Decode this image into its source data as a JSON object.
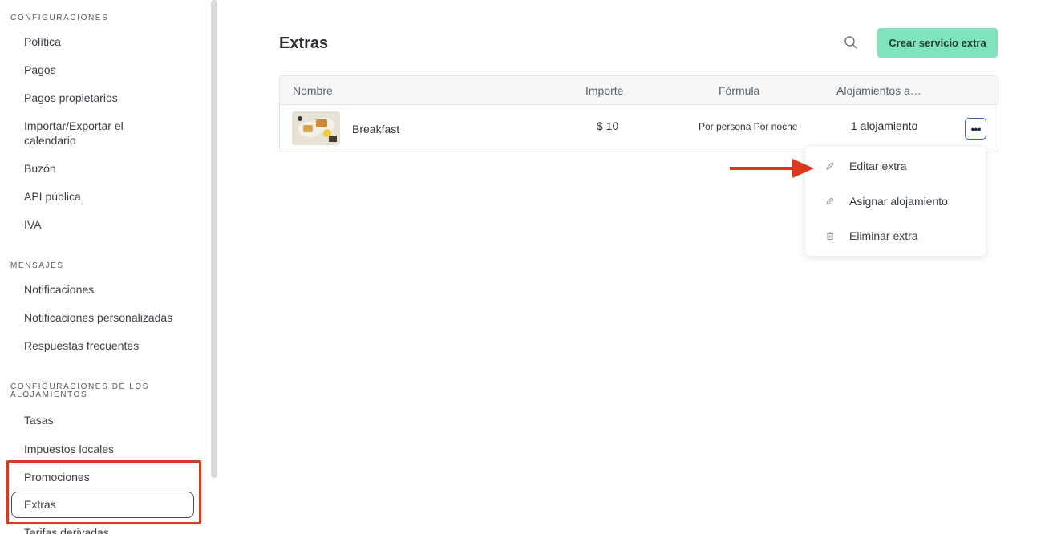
{
  "sidebar": {
    "sections": [
      {
        "title": "CONFIGURACIONES"
      },
      {
        "title": "MENSAJES"
      },
      {
        "title_line1": "CONFIGURACIONES DE LOS",
        "title_line2": "ALOJAMIENTOS"
      }
    ],
    "items": [
      {
        "label": "Política"
      },
      {
        "label": "Pagos"
      },
      {
        "label": "Pagos propietarios"
      },
      {
        "label_line1": "Importar/Exportar el",
        "label_line2": "calendario"
      },
      {
        "label": "Buzón"
      },
      {
        "label": "API pública"
      },
      {
        "label": "IVA"
      },
      {
        "label": "Notificaciones"
      },
      {
        "label": "Notificaciones personalizadas"
      },
      {
        "label": "Respuestas frecuentes"
      },
      {
        "label": "Tasas"
      },
      {
        "label": "Impuestos locales"
      },
      {
        "label": "Promociones"
      },
      {
        "label": "Extras",
        "selected": true
      },
      {
        "label": "Tarifas derivadas"
      }
    ]
  },
  "main": {
    "title": "Extras",
    "create_button": "Crear servicio extra",
    "table": {
      "headers": [
        "Nombre",
        "Importe",
        "Fórmula",
        "Alojamientos a…"
      ],
      "rows": [
        {
          "name": "Breakfast",
          "amount": "$ 10",
          "formula": "Por persona Por noche",
          "accommodations": "1 alojamiento",
          "more": "•••"
        }
      ]
    },
    "menu": {
      "items": [
        {
          "label": "Editar extra",
          "icon": "pencil-icon"
        },
        {
          "label": "Asignar alojamiento",
          "icon": "link-icon"
        },
        {
          "label": "Eliminar extra",
          "icon": "trash-icon"
        }
      ]
    }
  },
  "colors": {
    "accent_button": "#7fe3bd",
    "annotation_red": "#d9391f",
    "more_button_border": "#2d5ec9"
  }
}
